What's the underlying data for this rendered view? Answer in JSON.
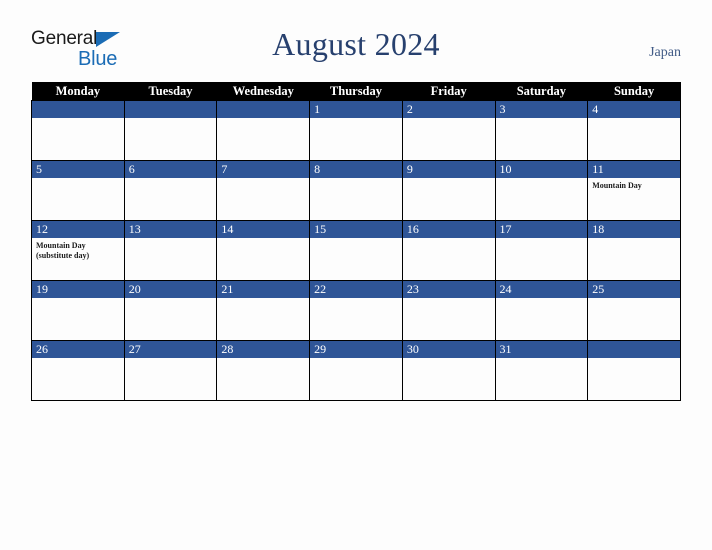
{
  "brand": {
    "name_part1": "General",
    "name_part2": "Blue",
    "triangle_color": "#1b6cb5"
  },
  "header": {
    "title": "August 2024",
    "country": "Japan"
  },
  "colors": {
    "day_band": "#2f5597",
    "header_bar": "#000000",
    "title_text": "#27406e",
    "country_text": "#415b86",
    "page_background": "#fdfdfd"
  },
  "weekday_headers": [
    "Monday",
    "Tuesday",
    "Wednesday",
    "Thursday",
    "Friday",
    "Saturday",
    "Sunday"
  ],
  "weeks": [
    [
      {
        "day": "",
        "events": []
      },
      {
        "day": "",
        "events": []
      },
      {
        "day": "",
        "events": []
      },
      {
        "day": "1",
        "events": []
      },
      {
        "day": "2",
        "events": []
      },
      {
        "day": "3",
        "events": []
      },
      {
        "day": "4",
        "events": []
      }
    ],
    [
      {
        "day": "5",
        "events": []
      },
      {
        "day": "6",
        "events": []
      },
      {
        "day": "7",
        "events": []
      },
      {
        "day": "8",
        "events": []
      },
      {
        "day": "9",
        "events": []
      },
      {
        "day": "10",
        "events": []
      },
      {
        "day": "11",
        "events": [
          "Mountain Day"
        ]
      }
    ],
    [
      {
        "day": "12",
        "events": [
          "Mountain Day",
          "(substitute day)"
        ]
      },
      {
        "day": "13",
        "events": []
      },
      {
        "day": "14",
        "events": []
      },
      {
        "day": "15",
        "events": []
      },
      {
        "day": "16",
        "events": []
      },
      {
        "day": "17",
        "events": []
      },
      {
        "day": "18",
        "events": []
      }
    ],
    [
      {
        "day": "19",
        "events": []
      },
      {
        "day": "20",
        "events": []
      },
      {
        "day": "21",
        "events": []
      },
      {
        "day": "22",
        "events": []
      },
      {
        "day": "23",
        "events": []
      },
      {
        "day": "24",
        "events": []
      },
      {
        "day": "25",
        "events": []
      }
    ],
    [
      {
        "day": "26",
        "events": []
      },
      {
        "day": "27",
        "events": []
      },
      {
        "day": "28",
        "events": []
      },
      {
        "day": "29",
        "events": []
      },
      {
        "day": "30",
        "events": []
      },
      {
        "day": "31",
        "events": []
      },
      {
        "day": "",
        "events": []
      }
    ]
  ]
}
